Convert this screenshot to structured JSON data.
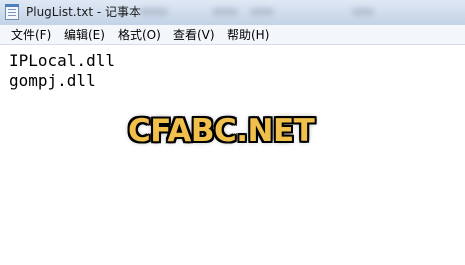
{
  "window": {
    "title": "PlugList.txt - 记事本",
    "icon": "notepad-icon"
  },
  "menu": [
    {
      "label": "文件(F)"
    },
    {
      "label": "编辑(E)"
    },
    {
      "label": "格式(O)"
    },
    {
      "label": "查看(V)"
    },
    {
      "label": "帮助(H)"
    }
  ],
  "editor": {
    "lines": [
      "IPLocal.dll",
      "gompj.dll"
    ]
  },
  "watermark": {
    "text": "CFABC.NET",
    "color": "#f1c04a"
  },
  "colors": {
    "titlebar": "#cfdcec",
    "menubar": "#f3f6fb",
    "editor_background": "#ffffff"
  }
}
